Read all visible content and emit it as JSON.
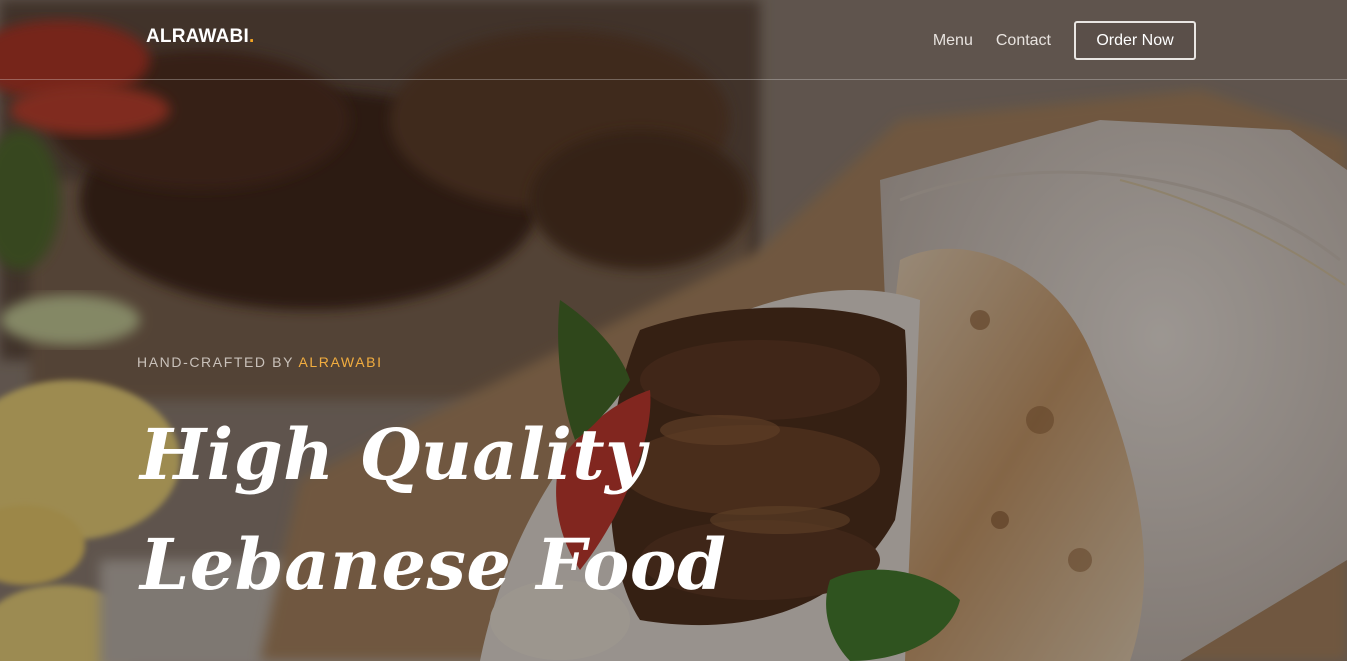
{
  "nav": {
    "brand": "ALRAWABI",
    "brand_dot": ".",
    "links": [
      {
        "label": "Menu"
      },
      {
        "label": "Contact"
      }
    ],
    "cta_label": "Order Now"
  },
  "hero": {
    "subtitle_prefix": "HAND-CRAFTED BY ",
    "subtitle_accent": "ALRAWABI",
    "headline_line1": "High Quality",
    "headline_line2": "Lebanese Food",
    "background_icon": "food-photo-shawarma-wrap"
  },
  "colors": {
    "accent": "#f5a623",
    "text_light": "#ffffff",
    "overlay": "#14100e"
  }
}
